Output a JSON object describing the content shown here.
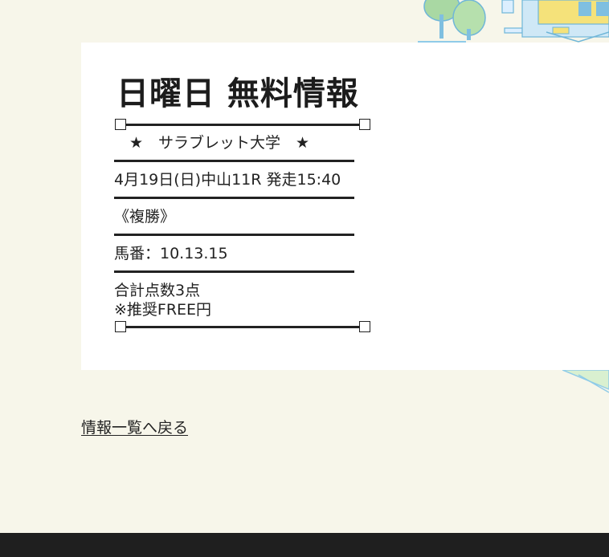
{
  "article": {
    "title": "日曜日 無料情報",
    "headline": "★　サラブレット大学　★",
    "race": "4月19日(日)中山11R 発走15:40",
    "bet_type": "《複勝》",
    "horse_numbers": "馬番：10.13.15",
    "points": "合計点数3点",
    "recommended": "※推奨FREE円"
  },
  "nav": {
    "back_label": "情報一覧へ戻る"
  },
  "colors": {
    "background": "#f7f6ea",
    "card": "#ffffff",
    "text": "#222222",
    "footer": "#1f1f1f"
  }
}
